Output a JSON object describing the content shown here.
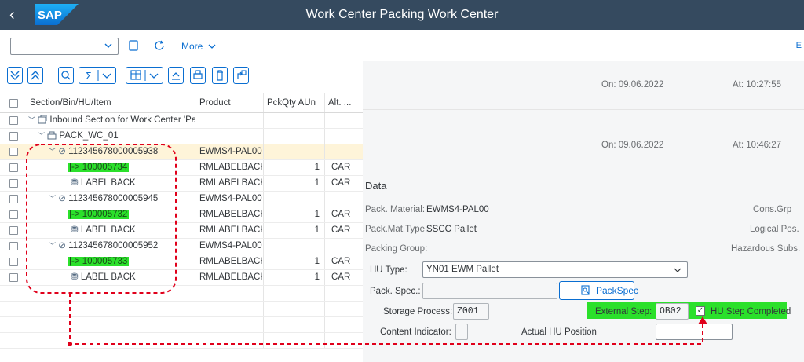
{
  "shell": {
    "back_glyph": "‹",
    "logo_text": "SAP",
    "title": "Work Center Packing Work Center"
  },
  "toolbar": {
    "combo_value": "",
    "more_label": "More",
    "edge_text": "E"
  },
  "tree": {
    "columns": [
      "Section/Bin/HU/Item",
      "Product",
      "PckQty AUn",
      "Alt. ..."
    ],
    "rows": [
      {
        "label": "Inbound Section for Work Center 'Pa",
        "product": "",
        "qty": "",
        "uom": ""
      },
      {
        "label": "PACK_WC_01",
        "product": "",
        "qty": "",
        "uom": ""
      },
      {
        "label": "112345678000005938",
        "product": "EWMS4-PAL00",
        "qty": "",
        "uom": ""
      },
      {
        "label": "|-> 100005734",
        "product": "RMLABELBACK",
        "qty": "1",
        "uom": "CAR"
      },
      {
        "label": "LABEL BACK",
        "product": "RMLABELBACK",
        "qty": "1",
        "uom": "CAR"
      },
      {
        "label": "112345678000005945",
        "product": "EWMS4-PAL00",
        "qty": "",
        "uom": ""
      },
      {
        "label": "|-> 100005732",
        "product": "RMLABELBACK",
        "qty": "1",
        "uom": "CAR"
      },
      {
        "label": "LABEL BACK",
        "product": "RMLABELBACK",
        "qty": "1",
        "uom": "CAR"
      },
      {
        "label": "112345678000005952",
        "product": "EWMS4-PAL00",
        "qty": "",
        "uom": ""
      },
      {
        "label": "|-> 100005733",
        "product": "RMLABELBACK",
        "qty": "1",
        "uom": "CAR"
      },
      {
        "label": "LABEL BACK",
        "product": "RMLABELBACK",
        "qty": "1",
        "uom": "CAR"
      }
    ]
  },
  "details": {
    "on1": "On: 09.06.2022",
    "at1": "At: 10:27:55",
    "on2": "On: 09.06.2022",
    "at2": "At: 10:46:27",
    "section_title": "Data",
    "pack_material_label": "Pack. Material:",
    "pack_material_value": "EWMS4-PAL00",
    "cons_grp_label": "Cons.Grp",
    "pack_mat_type_label": "Pack.Mat.Type:",
    "pack_mat_type_value": "SSCC Pallet",
    "logical_pos_label": "Logical Pos.",
    "packing_group_label": "Packing Group:",
    "hazardous_label": "Hazardous Subs.",
    "hu_type_label": "HU Type:",
    "hu_type_value": "YN01 EWM Pallet",
    "pack_spec_label": "Pack. Spec.:",
    "pack_spec_value": "",
    "packspec_button": "PackSpec",
    "storage_process_label": "Storage Process:",
    "storage_process_value": "Z001",
    "external_step_label": "External Step:",
    "external_step_value": "OB02",
    "hu_step_completed_label": "HU Step Completed",
    "hu_step_completed_checked": true,
    "content_indicator_label": "Content Indicator:",
    "actual_hu_position_label": "Actual HU Position",
    "actual_hu_position_value": ""
  },
  "colors": {
    "shell": "#354a5f",
    "accent": "#0a6ed1",
    "highlight_green": "#2be02b",
    "annotation_red": "#e0001b",
    "selected_row": "#fef4d9"
  }
}
